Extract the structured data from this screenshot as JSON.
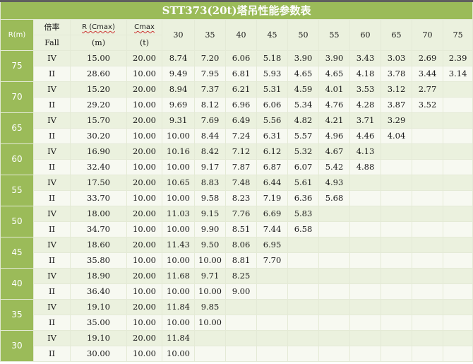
{
  "title": "STT373(20t)塔吊性能参数表",
  "header": {
    "r_label": "R(m)",
    "fall_cn": "倍率",
    "fall_en": "Fall",
    "rcmax_label": "R (Cmax)",
    "rcmax_unit": "(m)",
    "cmax_label": "Cmax",
    "cmax_unit": "(t)",
    "radii": [
      "30",
      "35",
      "40",
      "45",
      "50",
      "55",
      "60",
      "65",
      "70",
      "75"
    ]
  },
  "groups": [
    {
      "r": "75",
      "rows": [
        {
          "fall": "IV",
          "rcmax": "15.00",
          "cmax": "20.00",
          "loads": [
            "8.74",
            "7.20",
            "6.06",
            "5.18",
            "3.90",
            "3.90",
            "3.43",
            "3.03",
            "2.69",
            "2.39"
          ]
        },
        {
          "fall": "II",
          "rcmax": "28.60",
          "cmax": "10.00",
          "loads": [
            "9.49",
            "7.95",
            "6.81",
            "5.93",
            "4.65",
            "4.65",
            "4.18",
            "3.78",
            "3.44",
            "3.14"
          ]
        }
      ]
    },
    {
      "r": "70",
      "rows": [
        {
          "fall": "IV",
          "rcmax": "15.20",
          "cmax": "20.00",
          "loads": [
            "8.94",
            "7.37",
            "6.21",
            "5.31",
            "4.59",
            "4.01",
            "3.53",
            "3.12",
            "2.77",
            ""
          ]
        },
        {
          "fall": "II",
          "rcmax": "29.20",
          "cmax": "10.00",
          "loads": [
            "9.69",
            "8.12",
            "6.96",
            "6.06",
            "5.34",
            "4.76",
            "4.28",
            "3.87",
            "3.52",
            ""
          ]
        }
      ]
    },
    {
      "r": "65",
      "rows": [
        {
          "fall": "IV",
          "rcmax": "15.70",
          "cmax": "20.00",
          "loads": [
            "9.31",
            "7.69",
            "6.49",
            "5.56",
            "4.82",
            "4.21",
            "3.71",
            "3.29",
            "",
            ""
          ]
        },
        {
          "fall": "II",
          "rcmax": "30.20",
          "cmax": "10.00",
          "loads": [
            "10.00",
            "8.44",
            "7.24",
            "6.31",
            "5.57",
            "4.96",
            "4.46",
            "4.04",
            "",
            ""
          ]
        }
      ]
    },
    {
      "r": "60",
      "rows": [
        {
          "fall": "IV",
          "rcmax": "16.90",
          "cmax": "20.00",
          "loads": [
            "10.16",
            "8.42",
            "7.12",
            "6.12",
            "5.32",
            "4.67",
            "4.13",
            "",
            "",
            ""
          ]
        },
        {
          "fall": "II",
          "rcmax": "32.40",
          "cmax": "10.00",
          "loads": [
            "10.00",
            "9.17",
            "7.87",
            "6.87",
            "6.07",
            "5.42",
            "4.88",
            "",
            "",
            ""
          ]
        }
      ]
    },
    {
      "r": "55",
      "rows": [
        {
          "fall": "IV",
          "rcmax": "17.50",
          "cmax": "20.00",
          "loads": [
            "10.65",
            "8.83",
            "7.48",
            "6.44",
            "5.61",
            "4.93",
            "",
            "",
            "",
            ""
          ]
        },
        {
          "fall": "II",
          "rcmax": "33.70",
          "cmax": "10.00",
          "loads": [
            "10.00",
            "9.58",
            "8.23",
            "7.19",
            "6.36",
            "5.68",
            "",
            "",
            "",
            ""
          ]
        }
      ]
    },
    {
      "r": "50",
      "rows": [
        {
          "fall": "IV",
          "rcmax": "18.00",
          "cmax": "20.00",
          "loads": [
            "11.03",
            "9.15",
            "7.76",
            "6.69",
            "5.83",
            "",
            "",
            "",
            "",
            ""
          ]
        },
        {
          "fall": "II",
          "rcmax": "34.70",
          "cmax": "10.00",
          "loads": [
            "10.00",
            "9.90",
            "8.51",
            "7.44",
            "6.58",
            "",
            "",
            "",
            "",
            ""
          ]
        }
      ]
    },
    {
      "r": "45",
      "rows": [
        {
          "fall": "IV",
          "rcmax": "18.60",
          "cmax": "20.00",
          "loads": [
            "11.43",
            "9.50",
            "8.06",
            "6.95",
            "",
            "",
            "",
            "",
            "",
            ""
          ]
        },
        {
          "fall": "II",
          "rcmax": "35.80",
          "cmax": "10.00",
          "loads": [
            "10.00",
            "10.00",
            "8.81",
            "7.70",
            "",
            "",
            "",
            "",
            "",
            ""
          ]
        }
      ]
    },
    {
      "r": "40",
      "rows": [
        {
          "fall": "IV",
          "rcmax": "18.90",
          "cmax": "20.00",
          "loads": [
            "11.68",
            "9.71",
            "8.25",
            "",
            "",
            "",
            "",
            "",
            "",
            ""
          ]
        },
        {
          "fall": "II",
          "rcmax": "36.40",
          "cmax": "10.00",
          "loads": [
            "10.00",
            "10.00",
            "9.00",
            "",
            "",
            "",
            "",
            "",
            "",
            ""
          ]
        }
      ]
    },
    {
      "r": "35",
      "rows": [
        {
          "fall": "IV",
          "rcmax": "19.10",
          "cmax": "20.00",
          "loads": [
            "11.84",
            "9.85",
            "",
            "",
            "",
            "",
            "",
            "",
            "",
            ""
          ]
        },
        {
          "fall": "II",
          "rcmax": "35.00",
          "cmax": "10.00",
          "loads": [
            "10.00",
            "10.00",
            "",
            "",
            "",
            "",
            "",
            "",
            "",
            ""
          ]
        }
      ]
    },
    {
      "r": "30",
      "rows": [
        {
          "fall": "IV",
          "rcmax": "19.10",
          "cmax": "20.00",
          "loads": [
            "11.84",
            "",
            "",
            "",
            "",
            "",
            "",
            "",
            "",
            ""
          ]
        },
        {
          "fall": "II",
          "rcmax": "30.00",
          "cmax": "10.00",
          "loads": [
            "10.00",
            "",
            "",
            "",
            "",
            "",
            "",
            "",
            "",
            ""
          ]
        }
      ]
    }
  ]
}
